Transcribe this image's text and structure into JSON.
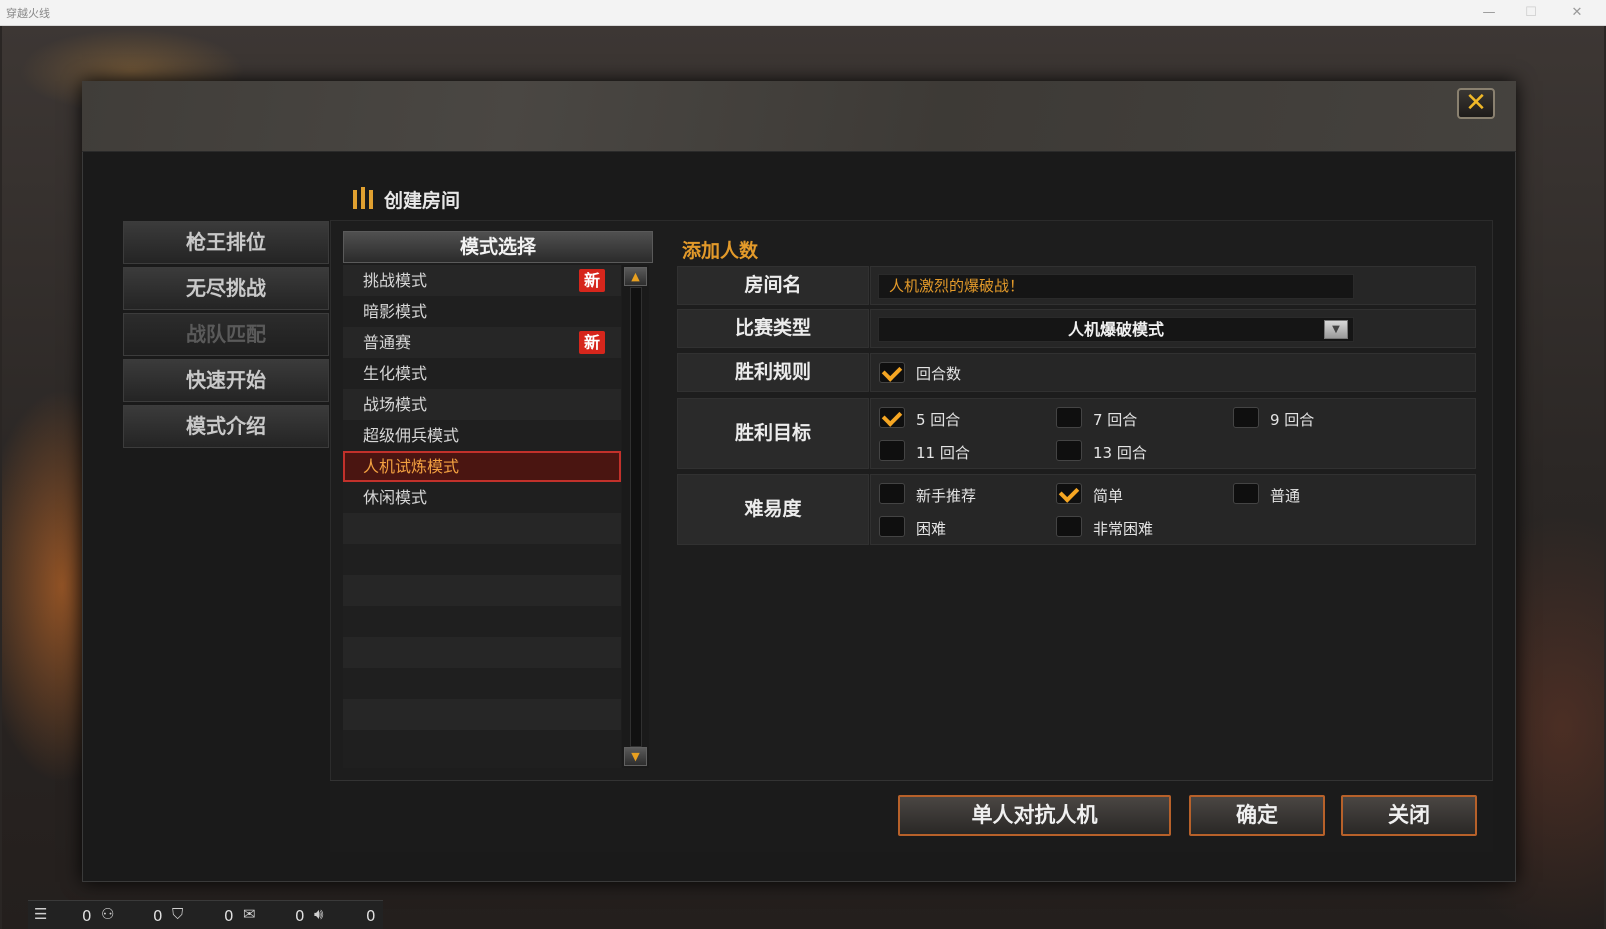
{
  "window": {
    "title": "穿越火线",
    "minimize": "—",
    "maximize": "☐",
    "close": "✕"
  },
  "dialog": {
    "close_icon": "✕"
  },
  "sidebar": {
    "items": [
      {
        "label": "枪王排位",
        "enabled": true
      },
      {
        "label": "无尽挑战",
        "enabled": true
      },
      {
        "label": "战队匹配",
        "enabled": false
      },
      {
        "label": "快速开始",
        "enabled": true
      },
      {
        "label": "模式介绍",
        "enabled": true
      }
    ]
  },
  "panel": {
    "title": "创建房间",
    "icon": "bullets-icon"
  },
  "mode_list": {
    "header": "模式选择",
    "badge_text": "新",
    "items": [
      {
        "label": "挑战模式",
        "new": true,
        "selected": false
      },
      {
        "label": "暗影模式",
        "new": false,
        "selected": false
      },
      {
        "label": "普通赛",
        "new": true,
        "selected": false
      },
      {
        "label": "生化模式",
        "new": false,
        "selected": false
      },
      {
        "label": "战场模式",
        "new": false,
        "selected": false
      },
      {
        "label": "超级佣兵模式",
        "new": false,
        "selected": false
      },
      {
        "label": "人机试炼模式",
        "new": false,
        "selected": true
      },
      {
        "label": "休闲模式",
        "new": false,
        "selected": false
      }
    ]
  },
  "settings": {
    "add_players": "添加人数",
    "room_name": {
      "label": "房间名",
      "value": "人机激烈的爆破战！"
    },
    "match_type": {
      "label": "比赛类型",
      "value": "人机爆破模式"
    },
    "win_rule": {
      "label": "胜利规则",
      "options": [
        {
          "label": "回合数",
          "checked": true
        }
      ]
    },
    "win_target": {
      "label": "胜利目标",
      "options": [
        {
          "label": "5 回合",
          "checked": true
        },
        {
          "label": "7 回合",
          "checked": false
        },
        {
          "label": "9 回合",
          "checked": false
        },
        {
          "label": "11 回合",
          "checked": false
        },
        {
          "label": "13 回合",
          "checked": false
        }
      ]
    },
    "difficulty": {
      "label": "难易度",
      "options": [
        {
          "label": "新手推荐",
          "checked": false
        },
        {
          "label": "简单",
          "checked": true
        },
        {
          "label": "普通",
          "checked": false
        },
        {
          "label": "困难",
          "checked": false
        },
        {
          "label": "非常困难",
          "checked": false
        }
      ]
    }
  },
  "buttons": {
    "solo_vs_ai": "单人对抗人机",
    "confirm": "确定",
    "close": "关闭"
  },
  "status_bar": {
    "counts": [
      "0",
      "0",
      "0",
      "0",
      "0"
    ]
  },
  "colors": {
    "accent": "#e39a2a",
    "badge": "#d6261c",
    "selected_border": "#c2312b"
  }
}
